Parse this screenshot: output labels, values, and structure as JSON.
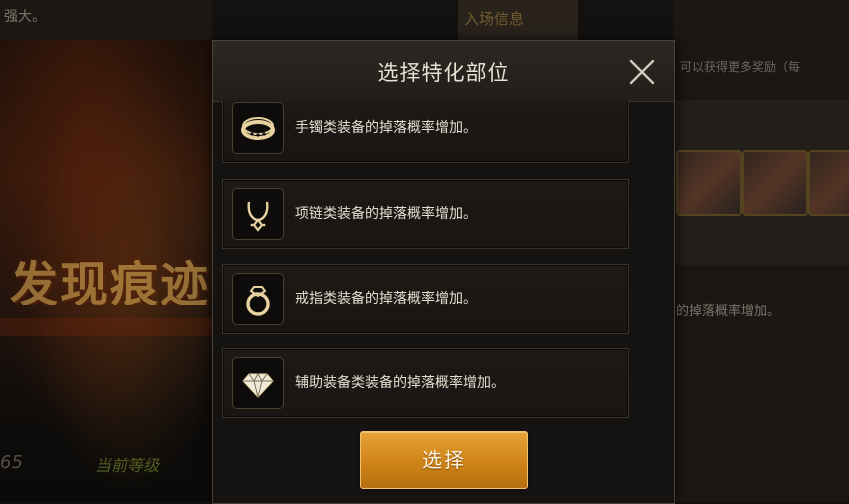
{
  "background": {
    "top_left_text": "强大。",
    "tab_label": "入场信息",
    "right_hint": "可以获得更多奖励（每",
    "banner_text": "发现痕迹",
    "bottom_left_number": "65",
    "bottom_left_tag": "当前等级",
    "right_drop_text": "的掉落概率增加。"
  },
  "dialog": {
    "title": "选择特化部位",
    "close_icon": "close-icon",
    "options": [
      {
        "icon": "bracelet-icon",
        "label": "手镯类装备的掉落概率增加。"
      },
      {
        "icon": "necklace-icon",
        "label": "项链类装备的掉落概率增加。"
      },
      {
        "icon": "ring-icon",
        "label": "戒指类装备的掉落概率增加。"
      },
      {
        "icon": "diamond-icon",
        "label": "辅助装备类装备的掉落概率增加。"
      }
    ],
    "select_label": "选择"
  },
  "colors": {
    "accent": "#cf8418",
    "icon_gold": "#e7d2a0",
    "text": "#e4ded0"
  }
}
